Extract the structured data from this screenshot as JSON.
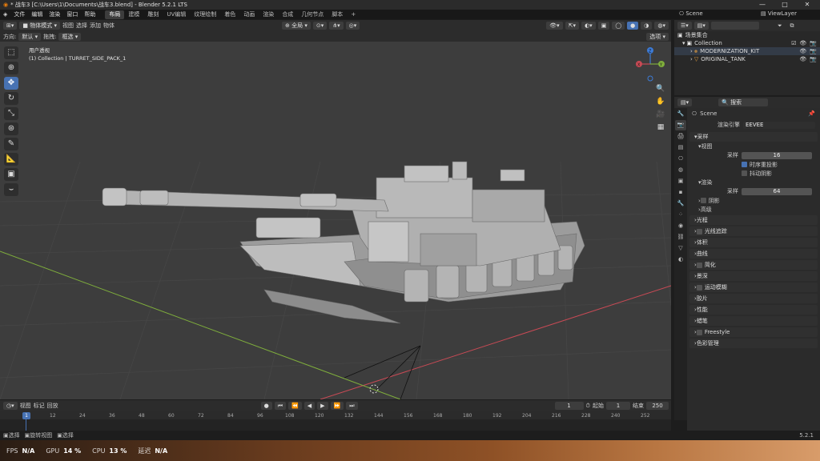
{
  "window": {
    "title": "* 战车3 [C:\\Users\\1\\Documents\\战车3.blend] - Blender 5.2.1 LTS",
    "min": "—",
    "max": "□",
    "close": "✕"
  },
  "menu": {
    "items": [
      "文件",
      "编辑",
      "渲染",
      "窗口",
      "帮助"
    ],
    "workspaces": [
      "布局",
      "建模",
      "雕刻",
      "UV编辑",
      "纹理绘制",
      "着色",
      "动画",
      "渲染",
      "合成",
      "几何节点",
      "脚本",
      "+"
    ],
    "active_workspace": "布局",
    "scene_label": "Scene",
    "viewlayer_label": "ViewLayer"
  },
  "viewport_header": {
    "mode": "物体模式",
    "menus": [
      "视图",
      "选择",
      "添加",
      "物体"
    ],
    "transform_space": "全局",
    "options": "选项"
  },
  "viewport_header2": {
    "orientation_label": "方向:",
    "orientation_value": "默认",
    "drag_label": "拖拽:",
    "drag_value": "框选"
  },
  "viewport": {
    "info_line1": "用户透视",
    "info_line2": "(1) Collection | TURRET_SIDE_PACK_1",
    "gizmo_x": "X",
    "gizmo_y": "Y",
    "gizmo_z": "Z"
  },
  "timeline": {
    "menus": [
      "回放",
      "视图",
      "标记"
    ],
    "current_frame": "1",
    "start_label": "起始",
    "start": "1",
    "end_label": "结束",
    "end": "250",
    "ticks": [
      "1",
      "12",
      "24",
      "36",
      "48",
      "60",
      "72",
      "84",
      "96",
      "108",
      "120",
      "132",
      "144",
      "156",
      "168",
      "180",
      "192",
      "204",
      "216",
      "228",
      "240",
      "252"
    ]
  },
  "status": {
    "left1": "选择",
    "left2": "旋转视图",
    "left3": "选择",
    "version": "5.2.1"
  },
  "overlay": {
    "fps_label": "FPS",
    "fps": "N/A",
    "gpu_label": "GPU",
    "gpu": "14 %",
    "cpu_label": "CPU",
    "cpu": "13 %",
    "lat_label": "延迟",
    "lat": "N/A"
  },
  "outliner": {
    "search_placeholder": "",
    "scene_collection": "场景集合",
    "items": [
      {
        "name": "Collection",
        "level": 1
      },
      {
        "name": "MODERNIZATION_KIT",
        "level": 2
      },
      {
        "name": "ORIGINAL_TANK",
        "level": 2
      }
    ]
  },
  "properties": {
    "search_placeholder": "搜索",
    "scene": "Scene",
    "render_engine_label": "渲染引擎",
    "render_engine": "EEVEE",
    "sampling": "采样",
    "viewport_sub": "视图",
    "samples_label": "采样",
    "viewport_samples": "16",
    "temporal_reprojection": "时序重投影",
    "jitter_shadows": "抖动阴影",
    "render_sub": "渲染",
    "render_samples": "64",
    "shadows": "阴影",
    "advanced": "高级",
    "sections": [
      "光程",
      "光线追踪",
      "体积",
      "曲线",
      "简化",
      "景深",
      "运动模糊",
      "胶片",
      "性能",
      "蜡笔",
      "Freestyle",
      "色彩管理"
    ]
  },
  "colors": {
    "accent": "#4772b3",
    "viewport_bg": "#3d3d3d",
    "x_axis": "#c84a55",
    "y_axis": "#7fae3c",
    "z_axis": "#3d7bd6"
  }
}
